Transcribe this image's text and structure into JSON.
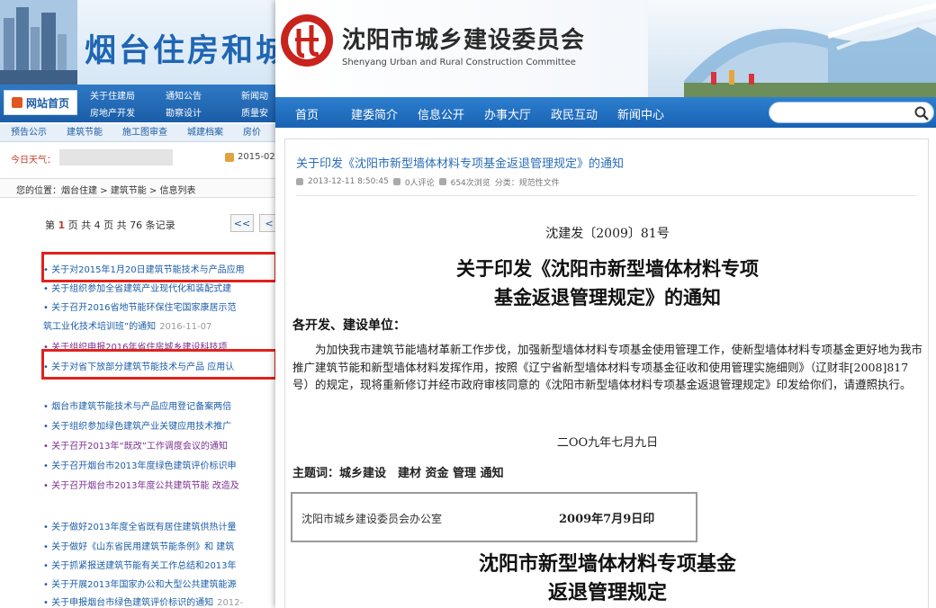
{
  "yantai": {
    "site_title": "烟台住房和城",
    "home_button": "网站首页",
    "nav": [
      "关于住建局",
      "通知公告",
      "新闻动",
      "房地产开发",
      "勘察设计",
      "质量安"
    ],
    "subnav": [
      "预告公示",
      "建筑节能",
      "施工图审查",
      "城建档案",
      "房价"
    ],
    "weather_label": "今日天气：",
    "date": "2015-02-",
    "breadcrumb": "您的位置：烟台住建 > 建筑节能 > 信息列表",
    "pager": {
      "prefix": "第 ",
      "current": "1",
      "suffix": " 页 共 4 页 共 76 条记录",
      "first_btn": "<<",
      "prev_btn": "<"
    },
    "news": [
      {
        "text": "• 关于对2015年1月20日建筑节能技术与产品应用",
        "date": "",
        "color": "blue"
      },
      {
        "text": "• 关于组织参加全省建筑产业现代化和装配式建",
        "date": "",
        "color": "blue"
      },
      {
        "text": "• 关于召开2016省地节能环保住宅国家康居示范",
        "date": "",
        "color": "blue"
      },
      {
        "text": "筑工业化技术培训班”的通知",
        "date": "2016-11-07",
        "color": "blue"
      },
      {
        "text": "• 关于组织申报2016年省住房城乡建设科技项",
        "date": "",
        "color": "purple"
      },
      {
        "text": "• 关于对省下放部分建筑节能技术与产品 应用认",
        "date": "",
        "color": "blue"
      },
      {
        "text": "• 烟台市建筑节能技术与产品应用登记备案两倍",
        "date": "",
        "color": "blue"
      },
      {
        "text": "• 关于组织参加绿色建筑产业关键应用技术推广",
        "date": "",
        "color": "blue"
      },
      {
        "text": "• 关于召开2013年“既改”工作调度会议的通知",
        "date": "",
        "color": "purple"
      },
      {
        "text": "• 关于召开烟台市2013年度绿色建筑评价标识申",
        "date": "",
        "color": "blue"
      },
      {
        "text": "• 关于召开烟台市2013年度公共建筑节能 改造及",
        "date": "",
        "color": "purple"
      },
      {
        "text": "• 关于做好2013年度全省既有居住建筑供热计量",
        "date": "",
        "color": "blue"
      },
      {
        "text": "• 关于做好《山东省民用建筑节能条例》和 建筑",
        "date": "",
        "color": "blue"
      },
      {
        "text": "• 关于抓紧报送建筑节能有关工作总结和2013年",
        "date": "",
        "color": "blue"
      },
      {
        "text": "• 关于开展2013年国家办公和大型公共建筑能源",
        "date": "",
        "color": "blue"
      },
      {
        "text": "• 关于申报烟台市绿色建筑评价标识的通知",
        "date": "2012-",
        "color": "blue"
      }
    ]
  },
  "shenyang": {
    "org_cn": "沈阳市城乡建设委员会",
    "org_en": "Shenyang Urban and Rural Construction Committee",
    "nav": [
      "首页",
      "建委简介",
      "信息公开",
      "办事大厅",
      "政民互动",
      "新闻中心"
    ],
    "search_placeholder": "",
    "article_title": "关于印发《沈阳市新型墙体材料专项基金返退管理规定》的通知",
    "meta": {
      "time": "2013-12-11 8:50:45",
      "comments": "0人评论",
      "views": "654次浏览",
      "category": "分类：规范性文件"
    },
    "doc_number": "沈建发〔2009〕81号",
    "doc_title_line1": "关于印发《沈阳市新型墙体材料专项",
    "doc_title_line2": "基金返退管理规定》的通知",
    "addressee": "各开发、建设单位：",
    "body": "为加快我市建筑节能墙材革新工作步伐，加强新型墙体材料专项基金使用管理工作，使新型墙体材料专项基金更好地为我市推广建筑节能和新型墙体材料发挥作用，按照《辽宁省新型墙体材料专项基金征收和使用管理实施细则》（辽财非[2008]817号）的规定，现将重新修订并经市政府审核同意的《沈阳市新型墙体材料专项基金返退管理规定》印发给你们，请遵照执行。",
    "date_line": "二OO九年七月九日",
    "subject_words": "主题词：城乡建设　建材 资金 管理 通知",
    "stamp_office": "沈阳市城乡建设委员会办公室",
    "stamp_date": "2009年7月9日印",
    "rule_title_line1": "沈阳市新型墙体材料专项基金",
    "rule_title_line2": "返退管理规定"
  }
}
